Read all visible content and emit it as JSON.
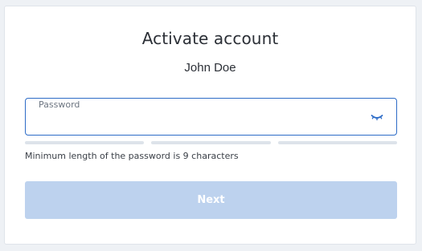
{
  "card": {
    "title": "Activate account",
    "user_name": "John Doe"
  },
  "password_field": {
    "label": "Password",
    "value": "",
    "toggle_icon": "eye-closed-icon"
  },
  "strength_meter": {
    "segments": 3,
    "filled": 0
  },
  "hint": "Minimum length of the password is 9 characters",
  "next_button": {
    "label": "Next",
    "enabled": false
  },
  "colors": {
    "accent": "#2d6cc7",
    "button_disabled": "#bdd2ee",
    "meter_empty": "#dde3ea"
  }
}
